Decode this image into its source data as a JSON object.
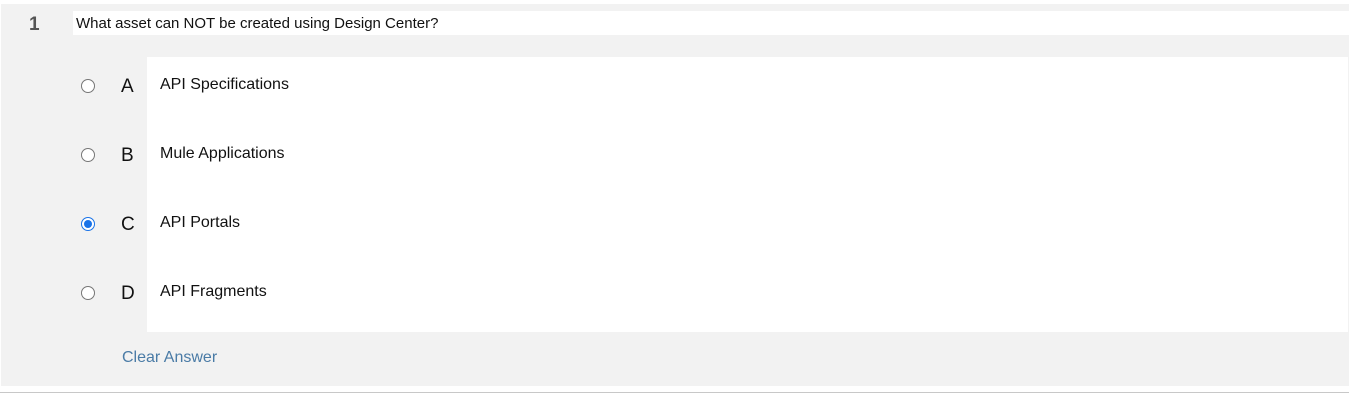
{
  "question": {
    "number": "1",
    "text": "What asset can NOT be created using Design Center?"
  },
  "options": [
    {
      "letter": "A",
      "text": "API Specifications",
      "selected": false
    },
    {
      "letter": "B",
      "text": "Mule Applications",
      "selected": false
    },
    {
      "letter": "C",
      "text": "API Portals",
      "selected": true
    },
    {
      "letter": "D",
      "text": "API Fragments",
      "selected": false
    }
  ],
  "footer": {
    "clear_label": "Clear Answer"
  },
  "colors": {
    "accent": "#1a73e8",
    "link": "#4a7ba6",
    "panel": "#f2f2f2"
  }
}
